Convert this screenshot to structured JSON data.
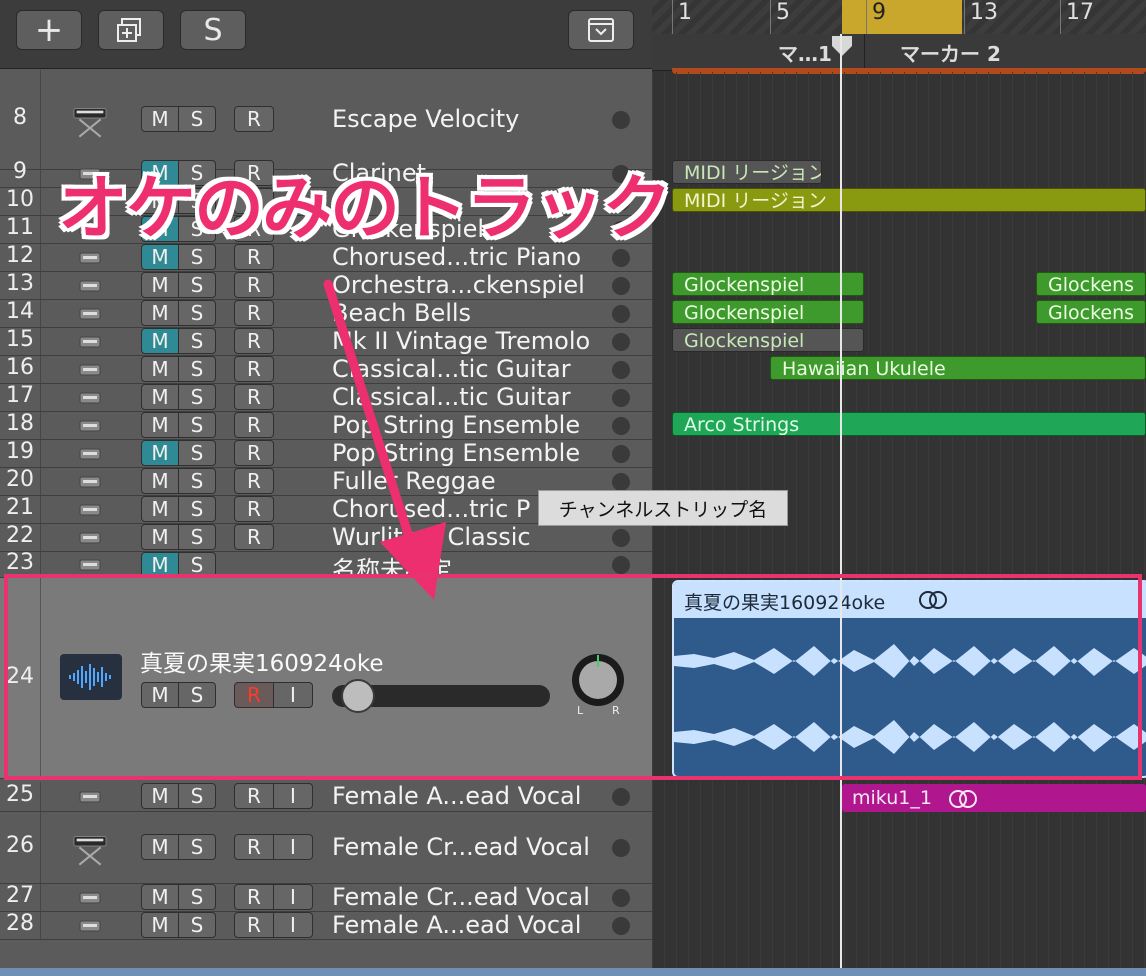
{
  "toolbar": {
    "add_label": "+",
    "add_folder_label": "",
    "solo_label": "S",
    "filter_label": ""
  },
  "ruler": {
    "bars": [
      "1",
      "5",
      "9",
      "13",
      "17"
    ],
    "markers": [
      "マ…1",
      "マーカー 2"
    ]
  },
  "tracks": [
    {
      "num": "8",
      "name": "Escape Velocity",
      "m": "M",
      "s": "S",
      "r": "R",
      "i": "",
      "mute_on": false,
      "icon": "synth-keyboard-icon"
    },
    {
      "num": "9",
      "name": "Clarinet",
      "m": "M",
      "s": "S",
      "r": "R",
      "i": "",
      "mute_on": true,
      "icon": "instrument-icon"
    },
    {
      "num": "10",
      "name": "",
      "m": "M",
      "s": "S",
      "r": "R",
      "i": "",
      "mute_on": false,
      "icon": "instrument-icon"
    },
    {
      "num": "11",
      "name": "Glockenspiel",
      "m": "M",
      "s": "S",
      "r": "R",
      "i": "",
      "mute_on": true,
      "icon": "instrument-icon"
    },
    {
      "num": "12",
      "name": "Chorused...tric Piano",
      "m": "M",
      "s": "S",
      "r": "R",
      "i": "",
      "mute_on": true,
      "icon": "electric-piano-icon"
    },
    {
      "num": "13",
      "name": "Orchestra...ckenspiel",
      "m": "M",
      "s": "S",
      "r": "R",
      "i": "",
      "mute_on": false,
      "icon": "glockenspiel-icon"
    },
    {
      "num": "14",
      "name": "Beach Bells",
      "m": "M",
      "s": "S",
      "r": "R",
      "i": "",
      "mute_on": false,
      "icon": "keyboard-stand-icon"
    },
    {
      "num": "15",
      "name": "Mk II Vintage Tremolo",
      "m": "M",
      "s": "S",
      "r": "R",
      "i": "",
      "mute_on": true,
      "icon": "electric-piano-icon"
    },
    {
      "num": "16",
      "name": "Classical...tic Guitar",
      "m": "M",
      "s": "S",
      "r": "R",
      "i": "",
      "mute_on": false,
      "icon": "guitar-icon"
    },
    {
      "num": "17",
      "name": "Classical...tic Guitar",
      "m": "M",
      "s": "S",
      "r": "R",
      "i": "",
      "mute_on": false,
      "icon": "guitar-icon"
    },
    {
      "num": "18",
      "name": "Pop String Ensemble",
      "m": "M",
      "s": "S",
      "r": "R",
      "i": "",
      "mute_on": false,
      "icon": "violin-icon"
    },
    {
      "num": "19",
      "name": "Pop String Ensemble",
      "m": "M",
      "s": "S",
      "r": "R",
      "i": "",
      "mute_on": true,
      "icon": "violin-icon"
    },
    {
      "num": "20",
      "name": "Fuller Reggae",
      "m": "M",
      "s": "S",
      "r": "R",
      "i": "",
      "mute_on": false,
      "icon": "organ-icon"
    },
    {
      "num": "21",
      "name": "Chorused...tric P",
      "m": "M",
      "s": "S",
      "r": "R",
      "i": "",
      "mute_on": false,
      "icon": "electric-piano-icon"
    },
    {
      "num": "22",
      "name": "Wurlitzer Classic",
      "m": "M",
      "s": "S",
      "r": "R",
      "i": "",
      "mute_on": false,
      "icon": "electric-piano-icon"
    },
    {
      "num": "23",
      "name": "名称未設定",
      "m": "M",
      "s": "S",
      "r": "",
      "i": "",
      "mute_on": true,
      "icon": "midi-note-icon"
    },
    {
      "num": "25",
      "name": "Female A...ead Vocal",
      "m": "M",
      "s": "S",
      "r": "R",
      "i": "I",
      "mute_on": false,
      "icon": "singer-icon"
    },
    {
      "num": "26",
      "name": "Female Cr...ead Vocal",
      "m": "M",
      "s": "S",
      "r": "R",
      "i": "I",
      "mute_on": false,
      "icon": "singer-icon"
    },
    {
      "num": "27",
      "name": "Female Cr...ead Vocal",
      "m": "M",
      "s": "S",
      "r": "R",
      "i": "I",
      "mute_on": false,
      "icon": "singer-icon"
    },
    {
      "num": "28",
      "name": "Female A...ead Vocal",
      "m": "M",
      "s": "S",
      "r": "R",
      "i": "I",
      "mute_on": false,
      "icon": "singer-icon"
    }
  ],
  "selected_track": {
    "num": "24",
    "name": "真夏の果実160924oke",
    "m": "M",
    "s": "S",
    "r": "R",
    "i": "I",
    "pan_l": "L",
    "pan_r": "R",
    "volume": 0.05,
    "icon": "audio-waveform-icon"
  },
  "regions": [
    {
      "label": "MIDI リージョン",
      "lane": 1,
      "style": "dim"
    },
    {
      "label": "MIDI リージョン",
      "lane": 2,
      "style": "olive"
    },
    {
      "label": "Glockenspiel",
      "lane": 5,
      "style": "green"
    },
    {
      "label": "Glockens",
      "lane": 5,
      "style": "green"
    },
    {
      "label": "Glockenspiel",
      "lane": 6,
      "style": "green"
    },
    {
      "label": "Glockens",
      "lane": 6,
      "style": "green"
    },
    {
      "label": "Glockenspiel",
      "lane": 7,
      "style": "dim"
    },
    {
      "label": "Hawaiian Ukulele",
      "lane": 8,
      "style": "green"
    },
    {
      "label": "Arco Strings",
      "lane": 10,
      "style": "strings"
    }
  ],
  "audio_region": {
    "label": "真夏の果実160924oke"
  },
  "vocal_region": {
    "label": "miku1_1"
  },
  "tooltip": "チャンネルストリップ名",
  "annotation": "オケのみのトラック",
  "colors": {
    "accent_pink": "#ee2f6f",
    "mute_teal": "#2f8a95",
    "audio_blue": "#2f5a8c",
    "vocal_magenta": "#b0178f"
  }
}
